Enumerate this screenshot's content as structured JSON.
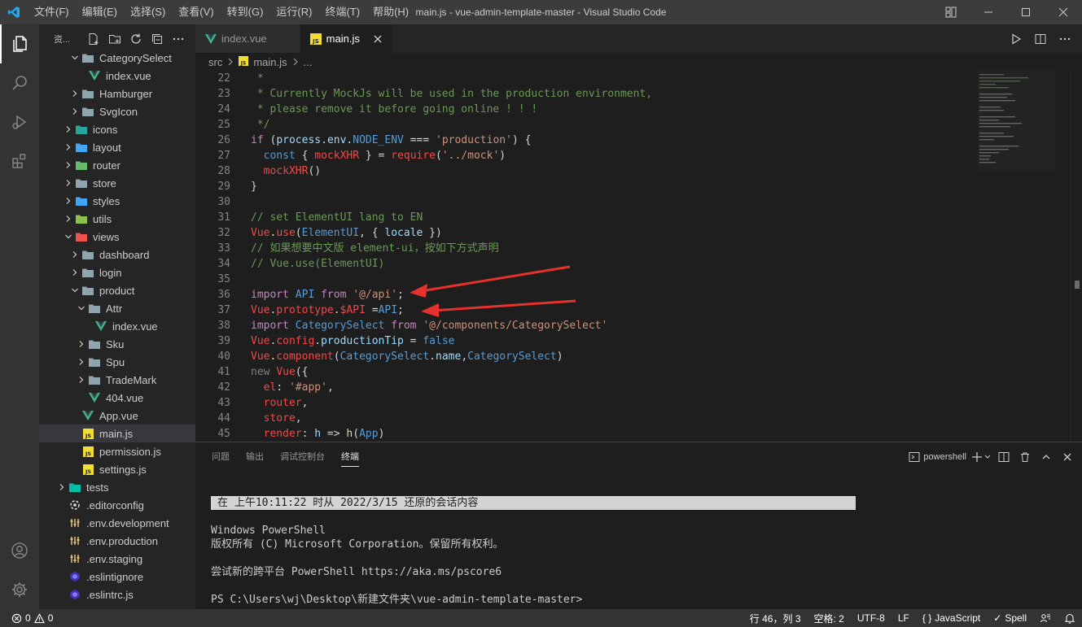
{
  "titlebar": {
    "menu": [
      "文件(F)",
      "编辑(E)",
      "选择(S)",
      "查看(V)",
      "转到(G)",
      "运行(R)",
      "终端(T)",
      "帮助(H)"
    ],
    "title": "main.js - vue-admin-template-master - Visual Studio Code"
  },
  "sidebar": {
    "title": "资...",
    "tree": [
      {
        "label": "CategorySelect",
        "depth": 2,
        "kind": "folder",
        "open": true,
        "icon": "folder"
      },
      {
        "label": "index.vue",
        "depth": 3,
        "kind": "file",
        "icon": "vue"
      },
      {
        "label": "Hamburger",
        "depth": 2,
        "kind": "folder",
        "open": false,
        "icon": "folder"
      },
      {
        "label": "SvgIcon",
        "depth": 2,
        "kind": "folder",
        "open": false,
        "icon": "folder"
      },
      {
        "label": "icons",
        "depth": 1,
        "kind": "folder",
        "open": false,
        "icon": "folder-icons"
      },
      {
        "label": "layout",
        "depth": 1,
        "kind": "folder",
        "open": false,
        "icon": "folder-layout"
      },
      {
        "label": "router",
        "depth": 1,
        "kind": "folder",
        "open": false,
        "icon": "folder-router"
      },
      {
        "label": "store",
        "depth": 1,
        "kind": "folder",
        "open": false,
        "icon": "folder"
      },
      {
        "label": "styles",
        "depth": 1,
        "kind": "folder",
        "open": false,
        "icon": "folder-styles"
      },
      {
        "label": "utils",
        "depth": 1,
        "kind": "folder",
        "open": false,
        "icon": "folder-utils"
      },
      {
        "label": "views",
        "depth": 1,
        "kind": "folder",
        "open": true,
        "icon": "folder-views"
      },
      {
        "label": "dashboard",
        "depth": 2,
        "kind": "folder",
        "open": false,
        "icon": "folder"
      },
      {
        "label": "login",
        "depth": 2,
        "kind": "folder",
        "open": false,
        "icon": "folder"
      },
      {
        "label": "product",
        "depth": 2,
        "kind": "folder",
        "open": true,
        "icon": "folder"
      },
      {
        "label": "Attr",
        "depth": 3,
        "kind": "folder",
        "open": true,
        "icon": "folder"
      },
      {
        "label": "index.vue",
        "depth": 4,
        "kind": "file",
        "icon": "vue"
      },
      {
        "label": "Sku",
        "depth": 3,
        "kind": "folder",
        "open": false,
        "icon": "folder"
      },
      {
        "label": "Spu",
        "depth": 3,
        "kind": "folder",
        "open": false,
        "icon": "folder"
      },
      {
        "label": "TradeMark",
        "depth": 3,
        "kind": "folder",
        "open": false,
        "icon": "folder"
      },
      {
        "label": "404.vue",
        "depth": 3,
        "kind": "file",
        "icon": "vue"
      },
      {
        "label": "App.vue",
        "depth": 2,
        "kind": "file",
        "icon": "vue"
      },
      {
        "label": "main.js",
        "depth": 2,
        "kind": "file",
        "icon": "js",
        "selected": true
      },
      {
        "label": "permission.js",
        "depth": 2,
        "kind": "file",
        "icon": "js"
      },
      {
        "label": "settings.js",
        "depth": 2,
        "kind": "file",
        "icon": "js"
      },
      {
        "label": "tests",
        "depth": 0,
        "kind": "folder",
        "open": false,
        "icon": "folder-tests"
      },
      {
        "label": ".editorconfig",
        "depth": 0,
        "kind": "file",
        "icon": "editorconfig"
      },
      {
        "label": ".env.development",
        "depth": 0,
        "kind": "file",
        "icon": "env"
      },
      {
        "label": ".env.production",
        "depth": 0,
        "kind": "file",
        "icon": "env"
      },
      {
        "label": ".env.staging",
        "depth": 0,
        "kind": "file",
        "icon": "env"
      },
      {
        "label": ".eslintignore",
        "depth": 0,
        "kind": "file",
        "icon": "eslint"
      },
      {
        "label": ".eslintrc.js",
        "depth": 0,
        "kind": "file",
        "icon": "eslint"
      }
    ]
  },
  "editor": {
    "tabs": [
      {
        "label": "index.vue",
        "icon": "vue",
        "active": false
      },
      {
        "label": "main.js",
        "icon": "js",
        "active": true
      }
    ],
    "breadcrumb": {
      "folder": "src",
      "file": "main.js",
      "more": "..."
    },
    "lines": [
      {
        "n": "22",
        "tokens": [
          [
            " *",
            "c-com"
          ]
        ]
      },
      {
        "n": "23",
        "tokens": [
          [
            " * Currently MockJs will be used in the production environment,",
            "c-com"
          ]
        ]
      },
      {
        "n": "24",
        "tokens": [
          [
            " * please remove it before going online ! ! !",
            "c-com"
          ]
        ]
      },
      {
        "n": "25",
        "tokens": [
          [
            " */",
            "c-com"
          ]
        ]
      },
      {
        "n": "26",
        "tokens": [
          [
            "if",
            "c-kw"
          ],
          [
            " (",
            ""
          ],
          [
            "process",
            "c-var"
          ],
          [
            ".",
            ""
          ],
          [
            "env",
            "c-var"
          ],
          [
            ".",
            ""
          ],
          [
            "NODE_ENV",
            "c-blue"
          ],
          [
            " === ",
            ""
          ],
          [
            "'production'",
            "c-str"
          ],
          [
            ") {",
            ""
          ]
        ]
      },
      {
        "n": "27",
        "tokens": [
          [
            "  ",
            ""
          ],
          [
            "const",
            "c-blue"
          ],
          [
            " { ",
            ""
          ],
          [
            "mockXHR",
            "c-red"
          ],
          [
            " } = ",
            ""
          ],
          [
            "require",
            "c-red"
          ],
          [
            "(",
            ""
          ],
          [
            "'../mock'",
            "c-str"
          ],
          [
            ")",
            ""
          ]
        ]
      },
      {
        "n": "28",
        "tokens": [
          [
            "  ",
            ""
          ],
          [
            "mockXHR",
            "c-red"
          ],
          [
            "()",
            ""
          ]
        ]
      },
      {
        "n": "29",
        "tokens": [
          [
            "}",
            ""
          ]
        ]
      },
      {
        "n": "30",
        "tokens": [
          [
            "",
            ""
          ]
        ]
      },
      {
        "n": "31",
        "tokens": [
          [
            "// set ElementUI lang to EN",
            "c-com"
          ]
        ]
      },
      {
        "n": "32",
        "tokens": [
          [
            "Vue",
            "c-red"
          ],
          [
            ".",
            ""
          ],
          [
            "use",
            "c-red"
          ],
          [
            "(",
            ""
          ],
          [
            "ElementUI",
            "c-blue"
          ],
          [
            ", { ",
            ""
          ],
          [
            "locale",
            "c-var"
          ],
          [
            " })",
            ""
          ]
        ]
      },
      {
        "n": "33",
        "tokens": [
          [
            "// 如果想要中文版 element-ui，按如下方式声明",
            "c-com"
          ]
        ]
      },
      {
        "n": "34",
        "tokens": [
          [
            "// Vue.use(ElementUI)",
            "c-com"
          ]
        ]
      },
      {
        "n": "35",
        "tokens": [
          [
            "",
            ""
          ]
        ]
      },
      {
        "n": "36",
        "tokens": [
          [
            "import",
            "c-kw"
          ],
          [
            " ",
            ""
          ],
          [
            "API",
            "c-blue"
          ],
          [
            " ",
            ""
          ],
          [
            "from",
            "c-kw"
          ],
          [
            " ",
            ""
          ],
          [
            "'@/api'",
            "c-str"
          ],
          [
            ";",
            ""
          ]
        ]
      },
      {
        "n": "37",
        "tokens": [
          [
            "Vue",
            "c-red"
          ],
          [
            ".",
            ""
          ],
          [
            "prototype",
            "c-red"
          ],
          [
            ".",
            ""
          ],
          [
            "$API",
            "c-red"
          ],
          [
            " =",
            ""
          ],
          [
            "API",
            "c-blue"
          ],
          [
            ";",
            ""
          ]
        ]
      },
      {
        "n": "38",
        "tokens": [
          [
            "import",
            "c-kw"
          ],
          [
            " ",
            ""
          ],
          [
            "CategorySelect",
            "c-blue"
          ],
          [
            " ",
            ""
          ],
          [
            "from",
            "c-kw"
          ],
          [
            " ",
            ""
          ],
          [
            "'@/components/CategorySelect'",
            "c-str"
          ]
        ]
      },
      {
        "n": "39",
        "tokens": [
          [
            "Vue",
            "c-red"
          ],
          [
            ".",
            ""
          ],
          [
            "config",
            "c-red"
          ],
          [
            ".",
            ""
          ],
          [
            "productionTip",
            "c-var"
          ],
          [
            " = ",
            ""
          ],
          [
            "false",
            "c-blue"
          ]
        ]
      },
      {
        "n": "40",
        "tokens": [
          [
            "Vue",
            "c-red"
          ],
          [
            ".",
            ""
          ],
          [
            "component",
            "c-red"
          ],
          [
            "(",
            ""
          ],
          [
            "CategorySelect",
            "c-blue"
          ],
          [
            ".",
            ""
          ],
          [
            "name",
            "c-var"
          ],
          [
            ",",
            ""
          ],
          [
            "CategorySelect",
            "c-blue"
          ],
          [
            ")",
            ""
          ]
        ]
      },
      {
        "n": "41",
        "tokens": [
          [
            "new",
            "c-dim"
          ],
          [
            " ",
            ""
          ],
          [
            "Vue",
            "c-red"
          ],
          [
            "({",
            ""
          ]
        ]
      },
      {
        "n": "42",
        "tokens": [
          [
            "  ",
            ""
          ],
          [
            "el",
            "c-red"
          ],
          [
            ": ",
            ""
          ],
          [
            "'#app'",
            "c-str"
          ],
          [
            ",",
            ""
          ]
        ]
      },
      {
        "n": "43",
        "tokens": [
          [
            "  ",
            ""
          ],
          [
            "router",
            "c-red"
          ],
          [
            ",",
            ""
          ]
        ]
      },
      {
        "n": "44",
        "tokens": [
          [
            "  ",
            ""
          ],
          [
            "store",
            "c-red"
          ],
          [
            ",",
            ""
          ]
        ]
      },
      {
        "n": "45",
        "tokens": [
          [
            "  ",
            ""
          ],
          [
            "render",
            "c-red"
          ],
          [
            ": ",
            ""
          ],
          [
            "h",
            "c-var"
          ],
          [
            " => ",
            ""
          ],
          [
            "h",
            "c-fn"
          ],
          [
            "(",
            ""
          ],
          [
            "App",
            "c-blue"
          ],
          [
            ")",
            ""
          ]
        ]
      }
    ]
  },
  "panel": {
    "tabs": [
      {
        "label": "问题",
        "active": false
      },
      {
        "label": "输出",
        "active": false
      },
      {
        "label": "调试控制台",
        "active": false
      },
      {
        "label": "终端",
        "active": true
      }
    ],
    "shell": "powershell",
    "terminal": {
      "restore": "在 上午10:11:22 时从 2022/3/15 还原的会话内容",
      "lines": [
        "Windows PowerShell",
        "版权所有 (C) Microsoft Corporation。保留所有权利。",
        "",
        "尝试新的跨平台 PowerShell https://aka.ms/pscore6",
        "",
        "PS C:\\Users\\wj\\Desktop\\新建文件夹\\vue-admin-template-master>"
      ]
    }
  },
  "statusbar": {
    "errors": "0",
    "warnings": "0",
    "position": "行 46，列 3",
    "spaces": "空格: 2",
    "encoding": "UTF-8",
    "eol": "LF",
    "language": "JavaScript",
    "spell": "Spell"
  }
}
